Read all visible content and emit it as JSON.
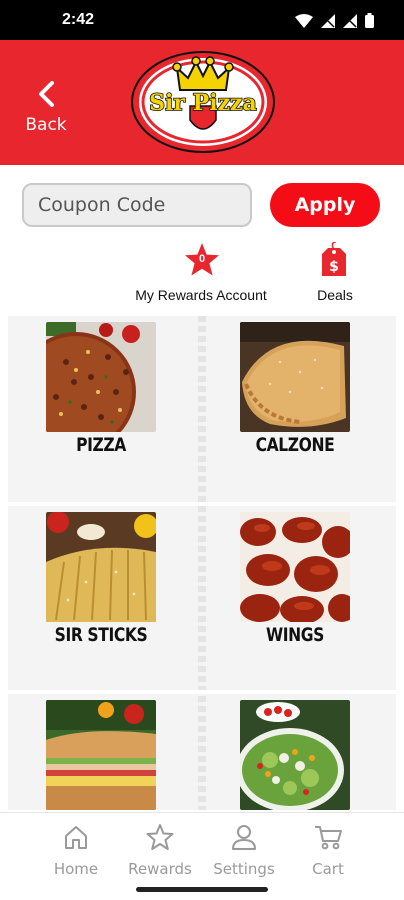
{
  "status_bar": {
    "time": "2:42"
  },
  "header": {
    "back_label": "Back",
    "logo_text": "Sir Pizza",
    "brand_color": "#e8262e"
  },
  "coupon": {
    "placeholder": "Coupon Code",
    "value": "",
    "apply_label": "Apply"
  },
  "rewards": {
    "label": "My Rewards Account",
    "count": "0"
  },
  "deals": {
    "label": "Deals",
    "icon_symbol": "$"
  },
  "menu": {
    "items": [
      {
        "label": "PIZZA"
      },
      {
        "label": "CALZONE"
      },
      {
        "label": "SIR STICKS"
      },
      {
        "label": "WINGS"
      },
      {
        "label": ""
      },
      {
        "label": ""
      }
    ]
  },
  "nav": {
    "items": [
      {
        "label": "Home",
        "icon": "home-icon"
      },
      {
        "label": "Rewards",
        "icon": "star-icon"
      },
      {
        "label": "Settings",
        "icon": "user-icon"
      },
      {
        "label": "Cart",
        "icon": "cart-icon"
      }
    ]
  }
}
